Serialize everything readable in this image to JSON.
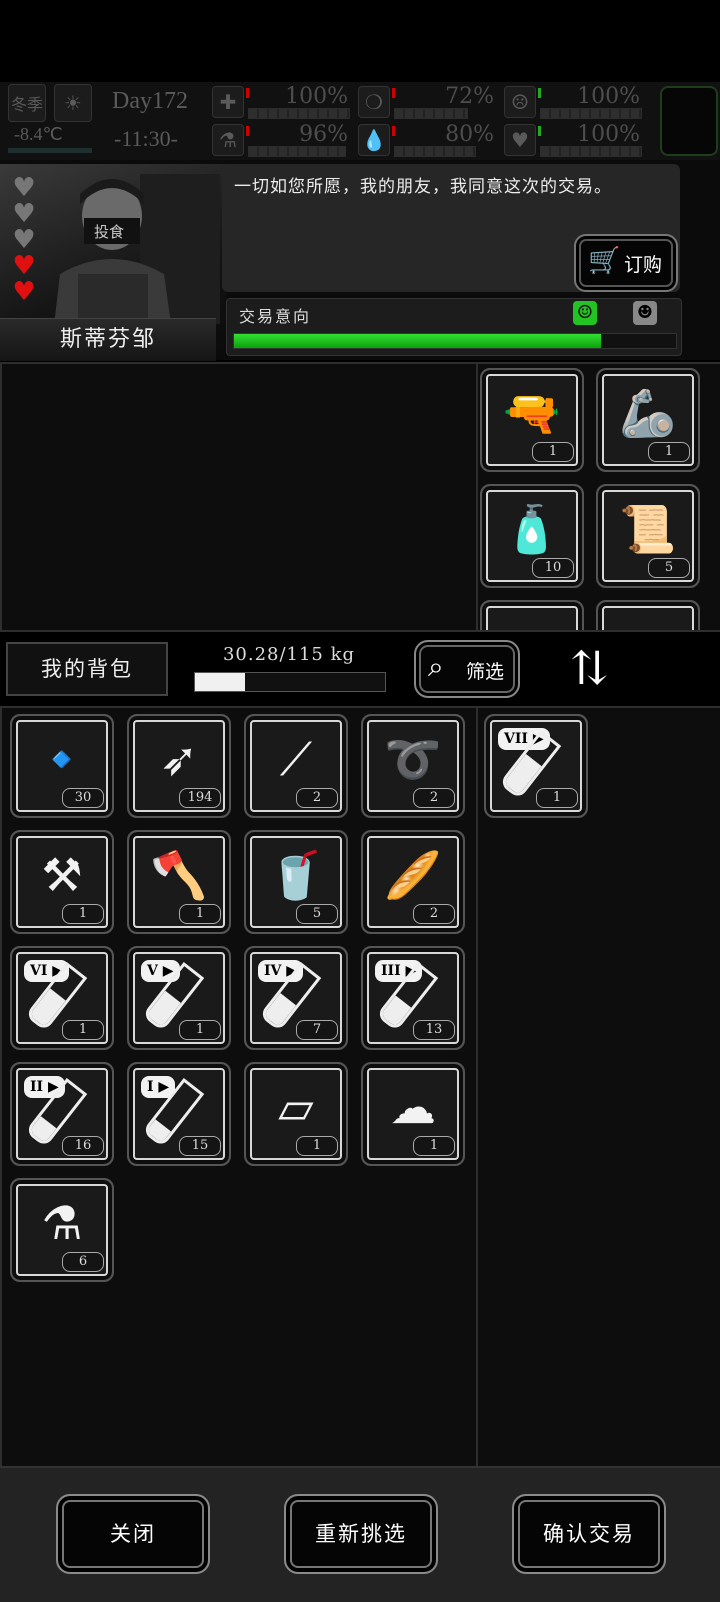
{
  "hud": {
    "season": "冬季",
    "temperature": "-8.4℃",
    "day": "Day172",
    "time": "-11:30-",
    "stats": [
      {
        "icon": "medkit-icon",
        "value": "100%",
        "level": 1.0,
        "tick": "#c00"
      },
      {
        "icon": "stomach-icon",
        "value": "72%",
        "level": 0.72,
        "tick": "#c00"
      },
      {
        "icon": "face-icon",
        "value": "100%",
        "level": 1.0,
        "tick": "#2a2"
      },
      {
        "icon": "flask-icon",
        "value": "96%",
        "level": 0.96,
        "tick": "#c00"
      },
      {
        "icon": "water-drop-icon",
        "value": "80%",
        "level": 0.8,
        "tick": "#c00"
      },
      {
        "icon": "heart-icon",
        "value": "100%",
        "level": 1.0,
        "tick": "#2a2"
      }
    ]
  },
  "npc": {
    "name": "斯蒂芬邹",
    "hearts_filled": 2,
    "hearts_total": 5,
    "dialog": "一切如您所愿，我的朋友，我同意这次的交易。",
    "order_label": "订购",
    "trade_intent_label": "交易意向",
    "trade_intent_level": 0.83
  },
  "trader_items": [
    {
      "name": "minigun",
      "glyph": "🔫",
      "count": "1"
    },
    {
      "name": "arm-guards",
      "glyph": "🦾",
      "count": "1"
    },
    {
      "name": "bottles",
      "glyph": "🧴",
      "count": "10"
    },
    {
      "name": "bandage-roll",
      "glyph": "📜",
      "count": "5"
    }
  ],
  "bag": {
    "label": "我的背包",
    "weight": "30.28/115 kg",
    "weight_level": 0.263,
    "filter_label": "筛选",
    "items": [
      {
        "name": "bullets",
        "glyph": "🔹",
        "count": "30"
      },
      {
        "name": "arrows",
        "glyph": "➶",
        "count": "194"
      },
      {
        "name": "lockpicks",
        "glyph": "⟋",
        "count": "2"
      },
      {
        "name": "rope",
        "glyph": "➰",
        "count": "2"
      },
      {
        "name": "shovel",
        "glyph": "⚒",
        "count": "1"
      },
      {
        "name": "hatchet",
        "glyph": "🪓",
        "count": "1"
      },
      {
        "name": "cola",
        "glyph": "🥤",
        "count": "5"
      },
      {
        "name": "bread",
        "glyph": "🥖",
        "count": "2"
      },
      {
        "name": "serum-vi",
        "roman": "VI",
        "fill": 0.55,
        "count": "1"
      },
      {
        "name": "serum-v",
        "roman": "V",
        "fill": 0.5,
        "count": "1"
      },
      {
        "name": "serum-iv",
        "roman": "IV",
        "fill": 0.45,
        "count": "7"
      },
      {
        "name": "serum-iii",
        "roman": "III",
        "fill": 0.4,
        "count": "13"
      },
      {
        "name": "serum-ii",
        "roman": "II",
        "fill": 0.3,
        "count": "16"
      },
      {
        "name": "serum-i",
        "roman": "I",
        "fill": 0.25,
        "count": "15"
      },
      {
        "name": "cloth",
        "glyph": "▱",
        "count": "1"
      },
      {
        "name": "towels",
        "glyph": "☁",
        "count": "1"
      },
      {
        "name": "beaker",
        "glyph": "⚗",
        "count": "6"
      }
    ]
  },
  "offer_items": [
    {
      "name": "serum-vii",
      "roman": "VII",
      "fill": 0.6,
      "count": "1"
    }
  ],
  "footer": {
    "close": "关闭",
    "reselect": "重新挑选",
    "confirm": "确认交易"
  }
}
